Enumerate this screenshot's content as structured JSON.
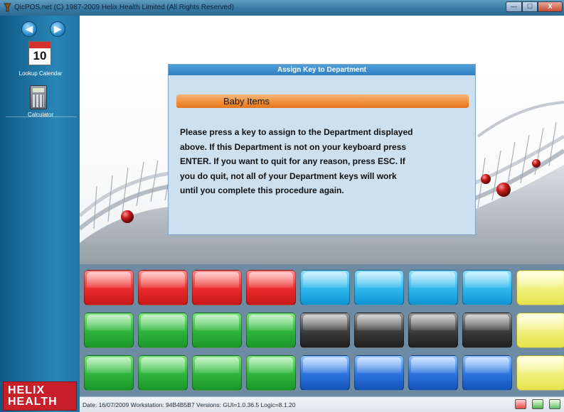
{
  "window": {
    "title": "QicPOS.net (C) 1987-2009 Helix Health Limited (All Rights Reserved)",
    "controls": {
      "minimize": "—",
      "maximize": "☐",
      "close": "X"
    }
  },
  "sidebar": {
    "nav": {
      "back": "◀",
      "forward": "▶"
    },
    "tiles": [
      {
        "label": "Lookup Calendar",
        "day": "10",
        "icon": "calendar-icon"
      },
      {
        "label": "Calculator",
        "icon": "calculator-icon"
      }
    ],
    "logo_lines": [
      "HELIX",
      "HEALTH"
    ]
  },
  "dialog": {
    "title": "Assign Key to Department",
    "department": "Baby Items",
    "instructions": "Please press a key to  assign to the Department displayed above.  If this Department  is not on your keyboard press ENTER.  If you want to quit for any reason, press ESC.  If you do quit, not all of your Department keys will work until you complete this procedure again."
  },
  "status": {
    "text": "Date: 16/07/2009  Workstation: 94B4B5B7  Versions: GUI=1.0.36.5  Logic=8.1.20"
  },
  "keys_grid": {
    "rows": [
      [
        "red",
        "red",
        "red",
        "red",
        "cyan",
        "cyan",
        "cyan",
        "cyan",
        "yellow"
      ],
      [
        "green",
        "green",
        "green",
        "green",
        "black",
        "black",
        "black",
        "black",
        "yellow"
      ],
      [
        "green",
        "green",
        "green",
        "green",
        "blue",
        "blue",
        "blue",
        "blue",
        "yellow"
      ]
    ]
  }
}
